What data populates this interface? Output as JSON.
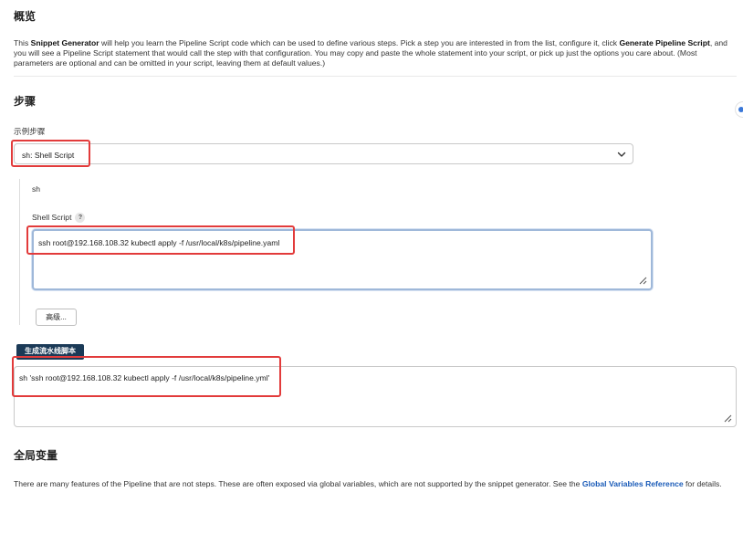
{
  "overview": {
    "title": "概览",
    "intro": [
      {
        "text": "This ",
        "bold": false
      },
      {
        "text": "Snippet Generator",
        "bold": true
      },
      {
        "text": " will help you learn the Pipeline Script code which can be used to define various steps. Pick a step you are interested in from the list, configure it, click ",
        "bold": false
      },
      {
        "text": "Generate Pipeline Script",
        "bold": true
      },
      {
        "text": ", and you will see a Pipeline Script statement that would call the step with that configuration. You may copy and paste the whole statement into your script, or pick up just the options you care about. (Most parameters are optional and can be omitted in your script, leaving them at default values.)",
        "bold": false
      }
    ]
  },
  "steps": {
    "title": "步骤",
    "sample_step_label": "示例步骤",
    "selected_step": "sh: Shell Script",
    "step_name": "sh",
    "shell_script_label": "Shell Script",
    "help_glyph": "?",
    "shell_script_value": "ssh root@192.168.108.32 kubectl apply -f /usr/local/k8s/pipeline.yaml",
    "advanced_button": "高级...",
    "generate_button": "生成流水线脚本",
    "generated_output": "sh 'ssh root@192.168.108.32 kubectl apply -f /usr/local/k8s/pipeline.yml'"
  },
  "globals": {
    "title": "全局变量",
    "text_before": "There are many features of the Pipeline that are not steps. These are often exposed via global variables, which are not supported by the snippet generator. See the ",
    "link": "Global Variables Reference",
    "text_after": " for details."
  },
  "colors": {
    "accent_dark": "#1b3a57",
    "highlight_red": "#e23b3b",
    "link_blue": "#1a5bb8"
  }
}
